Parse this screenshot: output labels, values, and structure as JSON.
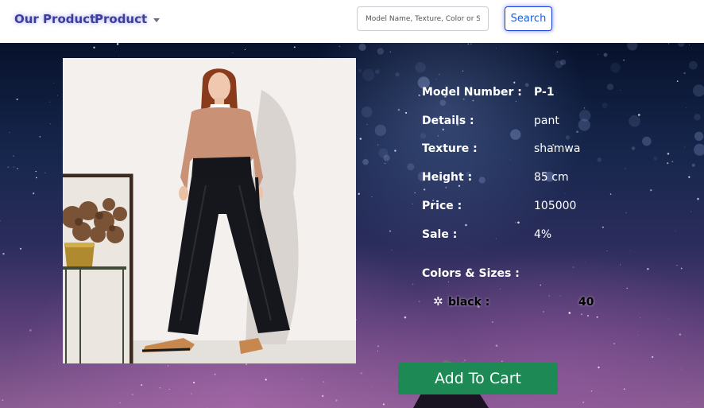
{
  "nav": {
    "brand": "Our Product",
    "dropdown_label": "Product",
    "search_placeholder": "Model Name, Texture, Color or Size",
    "search_button": "Search"
  },
  "product": {
    "details": [
      {
        "label": "Model Number :",
        "value": "P-1"
      },
      {
        "label": "Details :",
        "value": "pant"
      },
      {
        "label": "Texture :",
        "value": "shamwa"
      },
      {
        "label": "Height :",
        "value": "85 cm"
      },
      {
        "label": "Price :",
        "value": "105000"
      },
      {
        "label": "Sale :",
        "value": "4%"
      }
    ],
    "colors_heading": "Colors & Sizes :",
    "colors": [
      {
        "icon": "snowflake-icon",
        "color": "black :",
        "size": "40"
      }
    ],
    "add_to_cart": "Add To Cart"
  },
  "theme": {
    "brand_color": "#3c3f9a",
    "search_border": "#1e40d8",
    "cart_button": "#1d8a55"
  }
}
